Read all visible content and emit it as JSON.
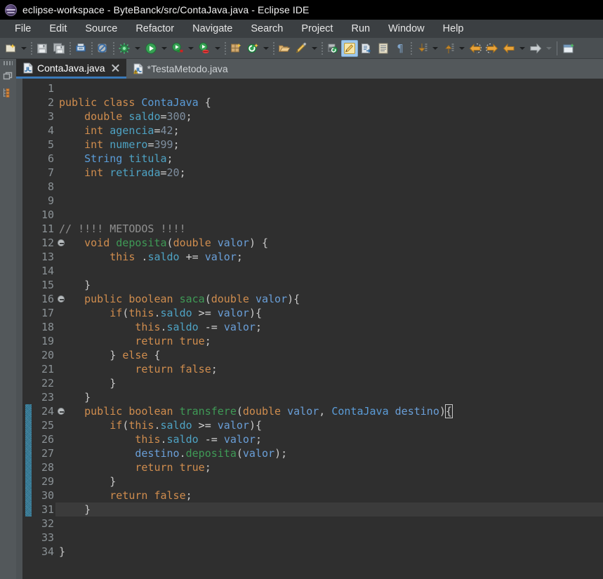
{
  "window": {
    "title": "eclipse-workspace - ByteBanck/src/ContaJava.java - Eclipse IDE",
    "logo_icon": "eclipse-logo-icon"
  },
  "menubar": {
    "items": [
      {
        "label": "File"
      },
      {
        "label": "Edit"
      },
      {
        "label": "Source"
      },
      {
        "label": "Refactor"
      },
      {
        "label": "Navigate"
      },
      {
        "label": "Search"
      },
      {
        "label": "Project"
      },
      {
        "label": "Run"
      },
      {
        "label": "Window"
      },
      {
        "label": "Help"
      }
    ]
  },
  "toolbar": {
    "items": [
      {
        "name": "new-wizard-icon",
        "kind": "icon",
        "tip": "New"
      },
      {
        "name": "new-dropdown-arrow",
        "kind": "arrow"
      },
      {
        "name": "separator",
        "kind": "sep"
      },
      {
        "name": "save-icon",
        "kind": "icon",
        "tip": "Save"
      },
      {
        "name": "save-all-icon",
        "kind": "icon",
        "tip": "Save All"
      },
      {
        "name": "separator",
        "kind": "sep"
      },
      {
        "name": "print-icon",
        "kind": "icon",
        "tip": "Print"
      },
      {
        "name": "separator",
        "kind": "sep"
      },
      {
        "name": "no-build-icon",
        "kind": "icon",
        "tip": "Build"
      },
      {
        "name": "separator",
        "kind": "sep"
      },
      {
        "name": "debug-icon",
        "kind": "icon",
        "tip": "Debug"
      },
      {
        "name": "debug-dropdown-arrow",
        "kind": "arrow"
      },
      {
        "name": "run-icon",
        "kind": "icon",
        "tip": "Run"
      },
      {
        "name": "run-dropdown-arrow",
        "kind": "arrow"
      },
      {
        "name": "run-coverage-icon",
        "kind": "icon",
        "tip": "Coverage"
      },
      {
        "name": "coverage-dropdown-arrow",
        "kind": "arrow"
      },
      {
        "name": "run-external-icon",
        "kind": "icon",
        "tip": "External Tools"
      },
      {
        "name": "external-dropdown-arrow",
        "kind": "arrow"
      },
      {
        "name": "separator",
        "kind": "sep"
      },
      {
        "name": "new-java-package-icon",
        "kind": "icon",
        "tip": "New Java Package"
      },
      {
        "name": "new-java-class-icon",
        "kind": "icon",
        "tip": "New Java Class"
      },
      {
        "name": "class-dropdown-arrow",
        "kind": "arrow"
      },
      {
        "name": "separator",
        "kind": "sep"
      },
      {
        "name": "open-type-icon",
        "kind": "icon",
        "tip": "Open Type"
      },
      {
        "name": "edit-pencil-icon",
        "kind": "icon",
        "tip": "Edit"
      },
      {
        "name": "pencil-dropdown-arrow",
        "kind": "arrow"
      },
      {
        "name": "separator",
        "kind": "sep"
      },
      {
        "name": "search-type-icon",
        "kind": "icon",
        "tip": "Search"
      },
      {
        "name": "toggle-mark-occurrences-icon",
        "kind": "icon",
        "tip": "Toggle Mark Occurrences",
        "active": true
      },
      {
        "name": "new-editor-icon",
        "kind": "icon",
        "tip": "New Editor"
      },
      {
        "name": "show-whitespace-icon",
        "kind": "icon",
        "tip": "Show Source Quick View"
      },
      {
        "name": "pilcrow-icon",
        "kind": "icon",
        "tip": "Show Whitespace Characters"
      },
      {
        "name": "separator",
        "kind": "sep"
      },
      {
        "name": "next-annotation-icon",
        "kind": "icon",
        "tip": "Next Annotation"
      },
      {
        "name": "next-annotation-arrow",
        "kind": "arrow"
      },
      {
        "name": "previous-annotation-icon",
        "kind": "icon",
        "tip": "Previous Annotation"
      },
      {
        "name": "previous-annotation-arrow",
        "kind": "arrow"
      },
      {
        "name": "last-edit-location-icon",
        "kind": "icon",
        "tip": "Last Edit Location"
      },
      {
        "name": "forward-edit-icon",
        "kind": "icon",
        "tip": "Forward"
      },
      {
        "name": "back-history-icon",
        "kind": "icon",
        "tip": "Back"
      },
      {
        "name": "back-dropdown-arrow",
        "kind": "arrow"
      },
      {
        "name": "forward-history-icon",
        "kind": "icon",
        "tip": "Forward"
      },
      {
        "name": "forward-dropdown-arrow",
        "kind": "arrow",
        "dim": true
      },
      {
        "name": "line",
        "kind": "line"
      },
      {
        "name": "new-window-icon",
        "kind": "icon",
        "tip": "New Window"
      }
    ]
  },
  "leftstrip": {
    "items": [
      {
        "name": "restore-view-icon"
      },
      {
        "name": "outline-view-icon"
      }
    ]
  },
  "tabs": [
    {
      "label": "ContaJava.java",
      "icon": "java-file-icon",
      "selected": true,
      "closable": true,
      "dirty": false
    },
    {
      "label": "*TestaMetodo.java",
      "icon": "java-file-warning-icon",
      "selected": false,
      "closable": false,
      "dirty": true
    }
  ],
  "editor": {
    "current_line": 31,
    "first_line": 1,
    "occurrence_bar": {
      "from_line": 24,
      "to_line": 31
    },
    "colors": {
      "background": "#2f2f2f",
      "current_line": "#3b3b3b",
      "gutter_text": "#8b9296",
      "keyword": "#d08d4e",
      "type": "#5b9dd9",
      "field": "#4ea3c4",
      "method": "#3f9a56",
      "variable": "#6a9fd8",
      "number": "#7f8fa0",
      "comment": "#8f8f8f",
      "default": "#d4d4d4",
      "occurrence_bar": "#2d7d9e",
      "tab_active_underline": "#3a79b8"
    },
    "lines": [
      {
        "n": 1,
        "fold": false,
        "tokens": []
      },
      {
        "n": 2,
        "fold": false,
        "tokens": [
          {
            "t": "public",
            "c": "k"
          },
          {
            "t": " ",
            "c": "op"
          },
          {
            "t": "class",
            "c": "k"
          },
          {
            "t": " ",
            "c": "op"
          },
          {
            "t": "ContaJava",
            "c": "ty"
          },
          {
            "t": " {",
            "c": "p"
          }
        ]
      },
      {
        "n": 3,
        "fold": false,
        "tokens": [
          {
            "t": "    ",
            "c": "op"
          },
          {
            "t": "double",
            "c": "k"
          },
          {
            "t": " ",
            "c": "op"
          },
          {
            "t": "saldo",
            "c": "fld"
          },
          {
            "t": "=",
            "c": "op"
          },
          {
            "t": "300",
            "c": "num"
          },
          {
            "t": ";",
            "c": "p"
          }
        ]
      },
      {
        "n": 4,
        "fold": false,
        "tokens": [
          {
            "t": "    ",
            "c": "op"
          },
          {
            "t": "int",
            "c": "k"
          },
          {
            "t": " ",
            "c": "op"
          },
          {
            "t": "agencia",
            "c": "fld"
          },
          {
            "t": "=",
            "c": "op"
          },
          {
            "t": "42",
            "c": "num"
          },
          {
            "t": ";",
            "c": "p"
          }
        ]
      },
      {
        "n": 5,
        "fold": false,
        "tokens": [
          {
            "t": "    ",
            "c": "op"
          },
          {
            "t": "int",
            "c": "k"
          },
          {
            "t": " ",
            "c": "op"
          },
          {
            "t": "numero",
            "c": "fld"
          },
          {
            "t": "=",
            "c": "op"
          },
          {
            "t": "399",
            "c": "num"
          },
          {
            "t": ";",
            "c": "p"
          }
        ]
      },
      {
        "n": 6,
        "fold": false,
        "tokens": [
          {
            "t": "    ",
            "c": "op"
          },
          {
            "t": "String",
            "c": "ty"
          },
          {
            "t": " ",
            "c": "op"
          },
          {
            "t": "titula",
            "c": "fld"
          },
          {
            "t": ";",
            "c": "p"
          }
        ]
      },
      {
        "n": 7,
        "fold": false,
        "tokens": [
          {
            "t": "    ",
            "c": "op"
          },
          {
            "t": "int",
            "c": "k"
          },
          {
            "t": " ",
            "c": "op"
          },
          {
            "t": "retirada",
            "c": "fld"
          },
          {
            "t": "=",
            "c": "op"
          },
          {
            "t": "20",
            "c": "num"
          },
          {
            "t": ";",
            "c": "p"
          }
        ]
      },
      {
        "n": 8,
        "fold": false,
        "tokens": []
      },
      {
        "n": 9,
        "fold": false,
        "tokens": []
      },
      {
        "n": 10,
        "fold": false,
        "tokens": []
      },
      {
        "n": 11,
        "fold": false,
        "tokens": [
          {
            "t": "// !!!! METODOS !!!!",
            "c": "cm"
          }
        ]
      },
      {
        "n": 12,
        "fold": true,
        "tokens": [
          {
            "t": "    ",
            "c": "op"
          },
          {
            "t": "void",
            "c": "k"
          },
          {
            "t": " ",
            "c": "op"
          },
          {
            "t": "deposita",
            "c": "mth"
          },
          {
            "t": "(",
            "c": "p"
          },
          {
            "t": "double",
            "c": "k"
          },
          {
            "t": " ",
            "c": "op"
          },
          {
            "t": "valor",
            "c": "var"
          },
          {
            "t": ") {",
            "c": "p"
          }
        ]
      },
      {
        "n": 13,
        "fold": false,
        "tokens": [
          {
            "t": "        ",
            "c": "op"
          },
          {
            "t": "this",
            "c": "k"
          },
          {
            "t": " .",
            "c": "p"
          },
          {
            "t": "saldo",
            "c": "fld"
          },
          {
            "t": " += ",
            "c": "op"
          },
          {
            "t": "valor",
            "c": "var"
          },
          {
            "t": ";",
            "c": "p"
          }
        ]
      },
      {
        "n": 14,
        "fold": false,
        "tokens": []
      },
      {
        "n": 15,
        "fold": false,
        "tokens": [
          {
            "t": "    }",
            "c": "p"
          }
        ]
      },
      {
        "n": 16,
        "fold": true,
        "tokens": [
          {
            "t": "    ",
            "c": "op"
          },
          {
            "t": "public",
            "c": "k"
          },
          {
            "t": " ",
            "c": "op"
          },
          {
            "t": "boolean",
            "c": "k"
          },
          {
            "t": " ",
            "c": "op"
          },
          {
            "t": "saca",
            "c": "mth"
          },
          {
            "t": "(",
            "c": "p"
          },
          {
            "t": "double",
            "c": "k"
          },
          {
            "t": " ",
            "c": "op"
          },
          {
            "t": "valor",
            "c": "var"
          },
          {
            "t": "){",
            "c": "p"
          }
        ]
      },
      {
        "n": 17,
        "fold": false,
        "tokens": [
          {
            "t": "        ",
            "c": "op"
          },
          {
            "t": "if",
            "c": "k"
          },
          {
            "t": "(",
            "c": "p"
          },
          {
            "t": "this",
            "c": "k"
          },
          {
            "t": ".",
            "c": "p"
          },
          {
            "t": "saldo",
            "c": "fld"
          },
          {
            "t": " >= ",
            "c": "op"
          },
          {
            "t": "valor",
            "c": "var"
          },
          {
            "t": "){",
            "c": "p"
          }
        ]
      },
      {
        "n": 18,
        "fold": false,
        "tokens": [
          {
            "t": "            ",
            "c": "op"
          },
          {
            "t": "this",
            "c": "k"
          },
          {
            "t": ".",
            "c": "p"
          },
          {
            "t": "saldo",
            "c": "fld"
          },
          {
            "t": " -= ",
            "c": "op"
          },
          {
            "t": "valor",
            "c": "var"
          },
          {
            "t": ";",
            "c": "p"
          }
        ]
      },
      {
        "n": 19,
        "fold": false,
        "tokens": [
          {
            "t": "            ",
            "c": "op"
          },
          {
            "t": "return",
            "c": "k"
          },
          {
            "t": " ",
            "c": "op"
          },
          {
            "t": "true",
            "c": "k"
          },
          {
            "t": ";",
            "c": "p"
          }
        ]
      },
      {
        "n": 20,
        "fold": false,
        "tokens": [
          {
            "t": "        } ",
            "c": "p"
          },
          {
            "t": "else",
            "c": "k"
          },
          {
            "t": " {",
            "c": "p"
          }
        ]
      },
      {
        "n": 21,
        "fold": false,
        "tokens": [
          {
            "t": "            ",
            "c": "op"
          },
          {
            "t": "return",
            "c": "k"
          },
          {
            "t": " ",
            "c": "op"
          },
          {
            "t": "false",
            "c": "k"
          },
          {
            "t": ";",
            "c": "p"
          }
        ]
      },
      {
        "n": 22,
        "fold": false,
        "tokens": [
          {
            "t": "        }",
            "c": "p"
          }
        ]
      },
      {
        "n": 23,
        "fold": false,
        "tokens": [
          {
            "t": "    }",
            "c": "p"
          }
        ]
      },
      {
        "n": 24,
        "fold": true,
        "tokens": [
          {
            "t": "    ",
            "c": "op"
          },
          {
            "t": "public",
            "c": "k"
          },
          {
            "t": " ",
            "c": "op"
          },
          {
            "t": "boolean",
            "c": "k"
          },
          {
            "t": " ",
            "c": "op"
          },
          {
            "t": "transfere",
            "c": "mth"
          },
          {
            "t": "(",
            "c": "p"
          },
          {
            "t": "double",
            "c": "k"
          },
          {
            "t": " ",
            "c": "op"
          },
          {
            "t": "valor",
            "c": "var"
          },
          {
            "t": ", ",
            "c": "p"
          },
          {
            "t": "ContaJava",
            "c": "ty"
          },
          {
            "t": " ",
            "c": "op"
          },
          {
            "t": "destino",
            "c": "var"
          },
          {
            "t": ")",
            "c": "p"
          },
          {
            "t": "{",
            "c": "p",
            "hl": true
          }
        ]
      },
      {
        "n": 25,
        "fold": false,
        "tokens": [
          {
            "t": "        ",
            "c": "op"
          },
          {
            "t": "if",
            "c": "k"
          },
          {
            "t": "(",
            "c": "p"
          },
          {
            "t": "this",
            "c": "k"
          },
          {
            "t": ".",
            "c": "p"
          },
          {
            "t": "saldo",
            "c": "fld"
          },
          {
            "t": " >= ",
            "c": "op"
          },
          {
            "t": "valor",
            "c": "var"
          },
          {
            "t": "){",
            "c": "p"
          }
        ]
      },
      {
        "n": 26,
        "fold": false,
        "tokens": [
          {
            "t": "            ",
            "c": "op"
          },
          {
            "t": "this",
            "c": "k"
          },
          {
            "t": ".",
            "c": "p"
          },
          {
            "t": "saldo",
            "c": "fld"
          },
          {
            "t": " -= ",
            "c": "op"
          },
          {
            "t": "valor",
            "c": "var"
          },
          {
            "t": ";",
            "c": "p"
          }
        ]
      },
      {
        "n": 27,
        "fold": false,
        "tokens": [
          {
            "t": "            ",
            "c": "op"
          },
          {
            "t": "destino",
            "c": "var"
          },
          {
            "t": ".",
            "c": "p"
          },
          {
            "t": "deposita",
            "c": "mth"
          },
          {
            "t": "(",
            "c": "p"
          },
          {
            "t": "valor",
            "c": "var"
          },
          {
            "t": ");",
            "c": "p"
          }
        ]
      },
      {
        "n": 28,
        "fold": false,
        "tokens": [
          {
            "t": "            ",
            "c": "op"
          },
          {
            "t": "return",
            "c": "k"
          },
          {
            "t": " ",
            "c": "op"
          },
          {
            "t": "true",
            "c": "k"
          },
          {
            "t": ";",
            "c": "p"
          }
        ]
      },
      {
        "n": 29,
        "fold": false,
        "tokens": [
          {
            "t": "        }",
            "c": "p"
          }
        ]
      },
      {
        "n": 30,
        "fold": false,
        "tokens": [
          {
            "t": "        ",
            "c": "op"
          },
          {
            "t": "return",
            "c": "k"
          },
          {
            "t": " ",
            "c": "op"
          },
          {
            "t": "false",
            "c": "k"
          },
          {
            "t": ";",
            "c": "p"
          }
        ]
      },
      {
        "n": 31,
        "fold": false,
        "current": true,
        "tokens": [
          {
            "t": "    }",
            "c": "p"
          }
        ]
      },
      {
        "n": 32,
        "fold": false,
        "tokens": []
      },
      {
        "n": 33,
        "fold": false,
        "tokens": []
      },
      {
        "n": 34,
        "fold": false,
        "tokens": [
          {
            "t": "}",
            "c": "p"
          }
        ]
      }
    ]
  }
}
